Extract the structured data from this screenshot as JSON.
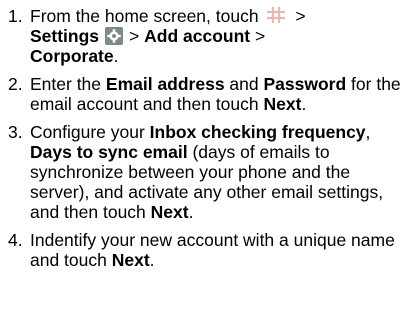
{
  "steps": [
    {
      "number": "1.",
      "parts": {
        "t1": "From the home screen, touch",
        "icon1": "apps-grid-icon",
        "t2": ">",
        "b1": "Settings",
        "icon2": "settings-gear-icon",
        "t3": "> ",
        "b2": "Add account",
        "t4": " > ",
        "b3": "Corporate",
        "t5": "."
      }
    },
    {
      "number": "2.",
      "parts": {
        "t1": "Enter the ",
        "b1": "Email address",
        "t2": " and ",
        "b2": "Password",
        "t3": " for the email account and then touch ",
        "b3": "Next",
        "t4": "."
      }
    },
    {
      "number": "3.",
      "parts": {
        "t1": "Configure your ",
        "b1": "Inbox checking frequency",
        "t2": ", ",
        "b2": "Days to sync email",
        "t3": " (days of emails to synchronize between your phone and the server), and activate any other email settings, and then touch ",
        "b3": "Next",
        "t4": "."
      }
    },
    {
      "number": "4.",
      "parts": {
        "t1": "Indentify your new account with a unique name and touch ",
        "b1": "Next",
        "t2": "."
      }
    }
  ],
  "colors": {
    "text": "#000000",
    "grid_icon": "#e9b8b0",
    "gear_icon_bg": "#7f8a88",
    "gear_icon_fg": "#ffffff"
  }
}
